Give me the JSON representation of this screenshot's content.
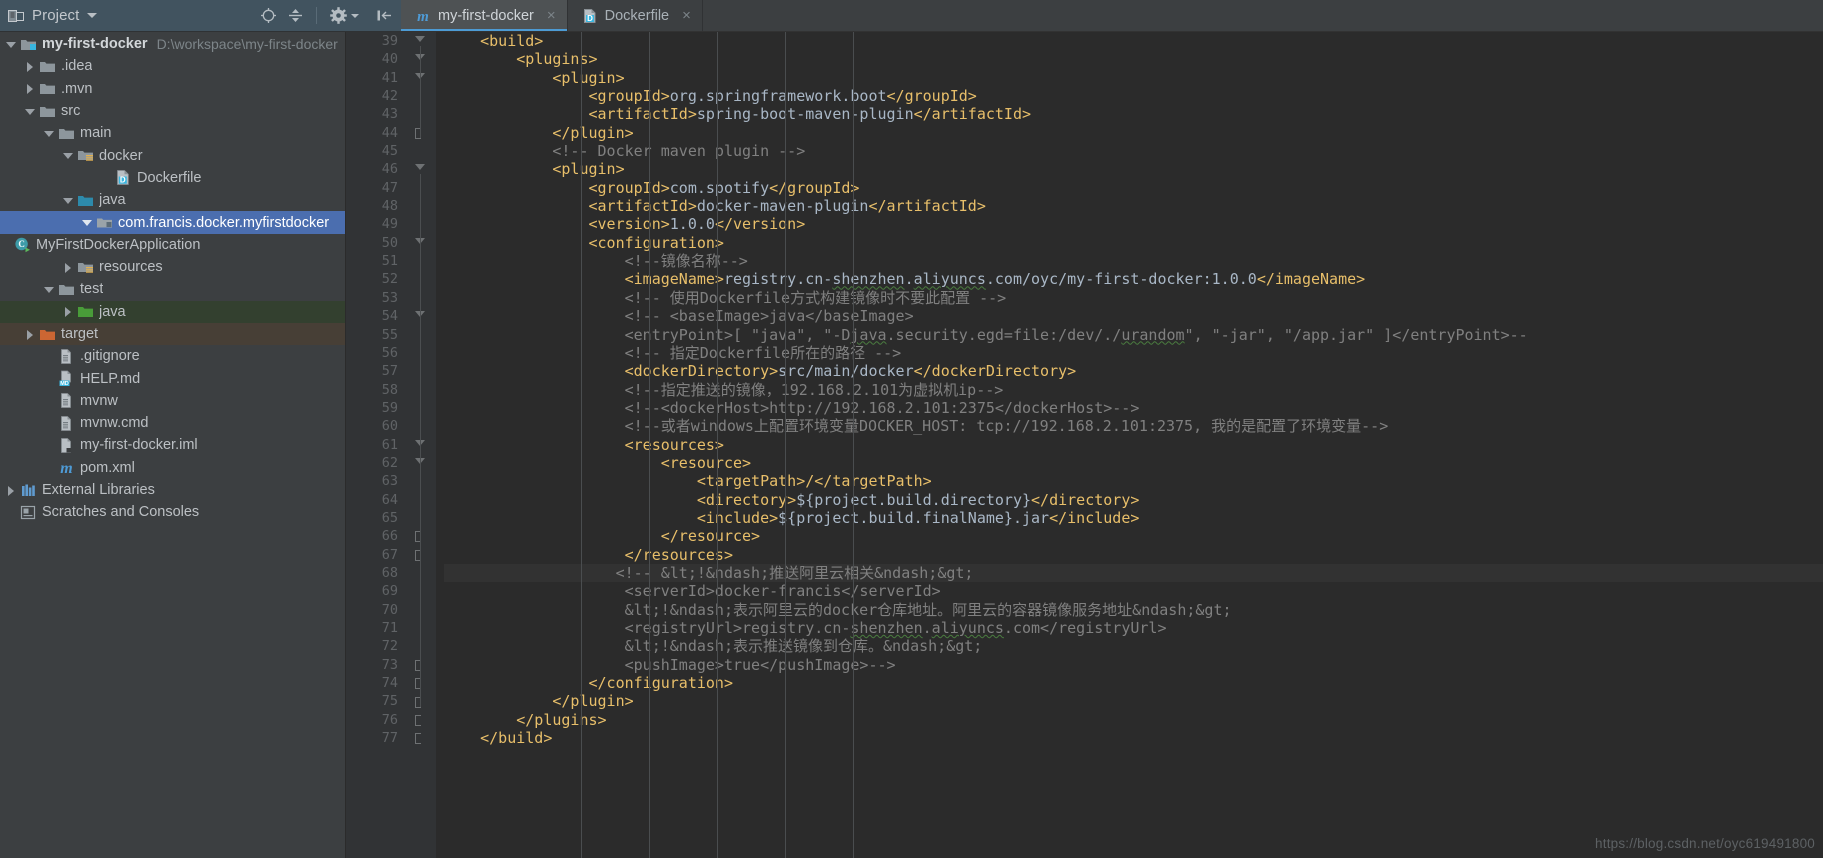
{
  "toolwindow": {
    "title": "Project",
    "icons": [
      {
        "name": "locate-icon",
        "glyph": "target"
      },
      {
        "name": "collapse-all-icon",
        "glyph": "collapse"
      },
      {
        "name": "settings-gear-icon",
        "glyph": "gear"
      },
      {
        "name": "hide-panel-icon",
        "glyph": "hide"
      }
    ]
  },
  "tabs": [
    {
      "label": "my-first-docker",
      "icon": "maven-pom-icon",
      "active": true,
      "close": "×"
    },
    {
      "label": "Dockerfile",
      "icon": "dockerfile-icon",
      "active": false,
      "close": "×"
    }
  ],
  "tree": [
    {
      "label": "my-first-docker",
      "path": "D:\\workspace\\my-first-docker",
      "indent": 0,
      "arrow": "down",
      "icon": "module-icon",
      "bold": true,
      "state": "normal"
    },
    {
      "label": ".idea",
      "path": "",
      "indent": 1,
      "arrow": "right",
      "icon": "folder-icon",
      "bold": false,
      "state": "normal"
    },
    {
      "label": ".mvn",
      "path": "",
      "indent": 1,
      "arrow": "right",
      "icon": "folder-icon",
      "bold": false,
      "state": "normal"
    },
    {
      "label": "src",
      "path": "",
      "indent": 1,
      "arrow": "down",
      "icon": "folder-icon",
      "bold": false,
      "state": "normal"
    },
    {
      "label": "main",
      "path": "",
      "indent": 2,
      "arrow": "down",
      "icon": "folder-icon",
      "bold": false,
      "state": "normal"
    },
    {
      "label": "docker",
      "path": "",
      "indent": 3,
      "arrow": "down",
      "icon": "resource-folder-icon",
      "bold": false,
      "state": "normal"
    },
    {
      "label": "Dockerfile",
      "path": "",
      "indent": 5,
      "arrow": "none",
      "icon": "dockerfile-icon",
      "bold": false,
      "state": "normal"
    },
    {
      "label": "java",
      "path": "",
      "indent": 3,
      "arrow": "down",
      "icon": "source-folder-icon",
      "bold": false,
      "state": "normal"
    },
    {
      "label": "com.francis.docker.myfirstdocker",
      "path": "",
      "indent": 4,
      "arrow": "down",
      "icon": "package-icon",
      "bold": false,
      "state": "selected"
    },
    {
      "label": "MyFirstDockerApplication",
      "path": "",
      "indent": 6,
      "arrow": "none",
      "icon": "java-runnable-class-icon",
      "bold": false,
      "state": "normal"
    },
    {
      "label": "resources",
      "path": "",
      "indent": 3,
      "arrow": "right",
      "icon": "resource-folder-icon",
      "bold": false,
      "state": "normal"
    },
    {
      "label": "test",
      "path": "",
      "indent": 2,
      "arrow": "down",
      "icon": "folder-icon",
      "bold": false,
      "state": "normal"
    },
    {
      "label": "java",
      "path": "",
      "indent": 3,
      "arrow": "right",
      "icon": "test-source-folder-icon",
      "bold": false,
      "state": "test"
    },
    {
      "label": "target",
      "path": "",
      "indent": 1,
      "arrow": "right",
      "icon": "excluded-folder-icon",
      "bold": false,
      "state": "excluded"
    },
    {
      "label": ".gitignore",
      "path": "",
      "indent": 2,
      "arrow": "none",
      "icon": "file-icon",
      "bold": false,
      "state": "normal"
    },
    {
      "label": "HELP.md",
      "path": "",
      "indent": 2,
      "arrow": "none",
      "icon": "markdown-file-icon",
      "bold": false,
      "state": "normal"
    },
    {
      "label": "mvnw",
      "path": "",
      "indent": 2,
      "arrow": "none",
      "icon": "file-icon",
      "bold": false,
      "state": "normal"
    },
    {
      "label": "mvnw.cmd",
      "path": "",
      "indent": 2,
      "arrow": "none",
      "icon": "file-icon",
      "bold": false,
      "state": "normal"
    },
    {
      "label": "my-first-docker.iml",
      "path": "",
      "indent": 2,
      "arrow": "none",
      "icon": "iml-file-icon",
      "bold": false,
      "state": "normal"
    },
    {
      "label": "pom.xml",
      "path": "",
      "indent": 2,
      "arrow": "none",
      "icon": "maven-pom-icon",
      "bold": false,
      "state": "normal"
    },
    {
      "label": "External Libraries",
      "path": "",
      "indent": 0,
      "arrow": "right",
      "icon": "libraries-icon",
      "bold": false,
      "state": "normal"
    },
    {
      "label": "Scratches and Consoles",
      "path": "",
      "indent": 0,
      "arrow": "none",
      "icon": "scratches-icon",
      "bold": false,
      "state": "normal"
    }
  ],
  "editor": {
    "first_line": 39,
    "highlighted_line": 68,
    "run_marker_line": 43,
    "watermark": "https://blog.csdn.net/oyc619491800",
    "lines": [
      {
        "n": 39,
        "indent": 0,
        "fold": "minus",
        "segs": [
          {
            "t": "tag",
            "v": "    <build>"
          }
        ]
      },
      {
        "n": 40,
        "indent": 0,
        "fold": "minus",
        "segs": [
          {
            "t": "tag",
            "v": "        <plugins>"
          }
        ]
      },
      {
        "n": 41,
        "indent": 0,
        "fold": "minus",
        "segs": [
          {
            "t": "tag",
            "v": "            <plugin>"
          }
        ]
      },
      {
        "n": 42,
        "indent": 0,
        "fold": "",
        "segs": [
          {
            "t": "tag",
            "v": "                <groupId>"
          },
          {
            "t": "txt",
            "v": "org.springframework.boot"
          },
          {
            "t": "tag",
            "v": "</groupId>"
          }
        ]
      },
      {
        "n": 43,
        "indent": 0,
        "fold": "run",
        "segs": [
          {
            "t": "tag",
            "v": "                <artifactId>"
          },
          {
            "t": "txt",
            "v": "spring-boot-maven-plugin"
          },
          {
            "t": "tag",
            "v": "</artifactId>"
          }
        ]
      },
      {
        "n": 44,
        "indent": 0,
        "fold": "brkt",
        "segs": [
          {
            "t": "tag",
            "v": "            </plugin>"
          }
        ]
      },
      {
        "n": 45,
        "indent": 0,
        "fold": "",
        "segs": [
          {
            "t": "cmt",
            "v": "            <!-- Docker maven plugin -->"
          }
        ]
      },
      {
        "n": 46,
        "indent": 0,
        "fold": "minus",
        "segs": [
          {
            "t": "tag",
            "v": "            <plugin>"
          }
        ]
      },
      {
        "n": 47,
        "indent": 0,
        "fold": "",
        "segs": [
          {
            "t": "tag",
            "v": "                <groupId>"
          },
          {
            "t": "txt",
            "v": "com.spotify"
          },
          {
            "t": "tag",
            "v": "</groupId>"
          }
        ]
      },
      {
        "n": 48,
        "indent": 0,
        "fold": "",
        "segs": [
          {
            "t": "tag",
            "v": "                <artifactId>"
          },
          {
            "t": "txt",
            "v": "docker-maven-plugin"
          },
          {
            "t": "tag",
            "v": "</artifactId>"
          }
        ]
      },
      {
        "n": 49,
        "indent": 0,
        "fold": "",
        "segs": [
          {
            "t": "tag",
            "v": "                <version>"
          },
          {
            "t": "txt",
            "v": "1.0.0"
          },
          {
            "t": "tag",
            "v": "</version>"
          }
        ]
      },
      {
        "n": 50,
        "indent": 0,
        "fold": "minus",
        "segs": [
          {
            "t": "tag",
            "v": "                <configuration>"
          }
        ]
      },
      {
        "n": 51,
        "indent": 0,
        "fold": "",
        "segs": [
          {
            "t": "cmt",
            "v": "                    <!--镜像名称-->"
          }
        ]
      },
      {
        "n": 52,
        "indent": 0,
        "fold": "",
        "segs": [
          {
            "t": "tag",
            "v": "                    <imageName>"
          },
          {
            "t": "txt",
            "v": "registry.cn-"
          },
          {
            "t": "wavy",
            "v": "shenzhen"
          },
          {
            "t": "txt",
            "v": "."
          },
          {
            "t": "wavy",
            "v": "aliyuncs"
          },
          {
            "t": "txt",
            "v": ".com/oyc/my-first-docker:1.0.0"
          },
          {
            "t": "tag",
            "v": "</imageName>"
          }
        ]
      },
      {
        "n": 53,
        "indent": 0,
        "fold": "",
        "segs": [
          {
            "t": "cmt",
            "v": "                    <!-- 使用Dockerfile方式构建镜像时不要此配置 -->"
          }
        ]
      },
      {
        "n": 54,
        "indent": 0,
        "fold": "minus",
        "segs": [
          {
            "t": "cmt",
            "v": "                    <!-- <baseImage>java</baseImage>"
          }
        ]
      },
      {
        "n": 55,
        "indent": 0,
        "fold": "",
        "segs": [
          {
            "t": "cmt",
            "v": "                    <entryPoint>[ \"java\", \"-D"
          },
          {
            "t": "cmtwavy",
            "v": "java"
          },
          {
            "t": "cmt",
            "v": ".security.egd=file:/dev/./"
          },
          {
            "t": "cmtwavy",
            "v": "urandom"
          },
          {
            "t": "cmt",
            "v": "\", \"-jar\", \"/app.jar\" ]</entryPoint>--"
          }
        ]
      },
      {
        "n": 56,
        "indent": 0,
        "fold": "",
        "segs": [
          {
            "t": "cmt",
            "v": "                    <!-- 指定Dockerfile所在的路径 -->"
          }
        ]
      },
      {
        "n": 57,
        "indent": 0,
        "fold": "",
        "segs": [
          {
            "t": "tag",
            "v": "                    <dockerDirectory>"
          },
          {
            "t": "txt",
            "v": "src/main/docker"
          },
          {
            "t": "tag",
            "v": "</dockerDirectory>"
          }
        ]
      },
      {
        "n": 58,
        "indent": 0,
        "fold": "",
        "segs": [
          {
            "t": "cmt",
            "v": "                    <!--指定推送的镜像，192.168.2.101为虚拟机ip-->"
          }
        ]
      },
      {
        "n": 59,
        "indent": 0,
        "fold": "",
        "segs": [
          {
            "t": "cmt",
            "v": "                    <!--<dockerHost>http://192.168.2.101:2375</dockerHost>-->"
          }
        ]
      },
      {
        "n": 60,
        "indent": 0,
        "fold": "",
        "segs": [
          {
            "t": "cmt",
            "v": "                    <!--或者windows上配置环境变量DOCKER_HOST: tcp://192.168.2.101:2375, 我的是配置了环境变量-->"
          }
        ]
      },
      {
        "n": 61,
        "indent": 0,
        "fold": "minus",
        "segs": [
          {
            "t": "tag",
            "v": "                    <resources>"
          }
        ]
      },
      {
        "n": 62,
        "indent": 0,
        "fold": "minus",
        "segs": [
          {
            "t": "tag",
            "v": "                        <resource>"
          }
        ]
      },
      {
        "n": 63,
        "indent": 0,
        "fold": "",
        "segs": [
          {
            "t": "tag",
            "v": "                            <targetPath>"
          },
          {
            "t": "tag",
            "v": "/</targetPath>"
          }
        ]
      },
      {
        "n": 64,
        "indent": 0,
        "fold": "",
        "segs": [
          {
            "t": "tag",
            "v": "                            <directory>"
          },
          {
            "t": "txt",
            "v": "${project.build.directory}"
          },
          {
            "t": "tag",
            "v": "</directory>"
          }
        ]
      },
      {
        "n": 65,
        "indent": 0,
        "fold": "",
        "segs": [
          {
            "t": "tag",
            "v": "                            <include>"
          },
          {
            "t": "txt",
            "v": "${project.build.finalName}.jar"
          },
          {
            "t": "tag",
            "v": "</include>"
          }
        ]
      },
      {
        "n": 66,
        "indent": 0,
        "fold": "brkt",
        "segs": [
          {
            "t": "tag",
            "v": "                        </resource>"
          }
        ]
      },
      {
        "n": 67,
        "indent": 0,
        "fold": "brkt",
        "segs": [
          {
            "t": "tag",
            "v": "                    </resources>"
          }
        ]
      },
      {
        "n": 68,
        "indent": 0,
        "fold": "",
        "segs": [
          {
            "t": "cmt",
            "v": "                   <!-- &lt;!&ndash;推送阿里云相关&ndash;&gt;"
          }
        ]
      },
      {
        "n": 69,
        "indent": 0,
        "fold": "",
        "segs": [
          {
            "t": "cmt",
            "v": "                    <serverId>docker-francis</serverId>"
          }
        ]
      },
      {
        "n": 70,
        "indent": 0,
        "fold": "",
        "segs": [
          {
            "t": "cmt",
            "v": "                    &lt;!&ndash;表示阿里云的docker仓库地址。阿里云的容器镜像服务地址&ndash;&gt;"
          }
        ]
      },
      {
        "n": 71,
        "indent": 0,
        "fold": "",
        "segs": [
          {
            "t": "cmt",
            "v": "                    <registryUrl>registry.cn-"
          },
          {
            "t": "cmtwavy",
            "v": "shenzhen"
          },
          {
            "t": "cmt",
            "v": "."
          },
          {
            "t": "cmtwavy",
            "v": "aliyuncs"
          },
          {
            "t": "cmt",
            "v": ".com</registryUrl>"
          }
        ]
      },
      {
        "n": 72,
        "indent": 0,
        "fold": "",
        "segs": [
          {
            "t": "cmt",
            "v": "                    &lt;!&ndash;表示推送镜像到仓库。&ndash;&gt;"
          }
        ]
      },
      {
        "n": 73,
        "indent": 0,
        "fold": "brkt",
        "segs": [
          {
            "t": "cmt",
            "v": "                    <pushImage>true</pushImage>-->"
          }
        ]
      },
      {
        "n": 74,
        "indent": 0,
        "fold": "brkt",
        "segs": [
          {
            "t": "tag",
            "v": "                </configuration>"
          }
        ]
      },
      {
        "n": 75,
        "indent": 0,
        "fold": "brkt",
        "segs": [
          {
            "t": "tag",
            "v": "            </plugin>"
          }
        ]
      },
      {
        "n": 76,
        "indent": 0,
        "fold": "brkt",
        "segs": [
          {
            "t": "tag",
            "v": "        </plugins>"
          }
        ]
      },
      {
        "n": 77,
        "indent": 0,
        "fold": "brkt",
        "segs": [
          {
            "t": "tag",
            "v": "    </build>"
          }
        ]
      }
    ]
  },
  "colors": {
    "editor_bg": "#2b2b2b",
    "gutter_bg": "#313335",
    "panel_bg": "#3c3f41",
    "header_bg": "#41535f",
    "selection_blue": "#4b6eaf",
    "tag_orange": "#e8bf6a",
    "text_blue": "#a9b7c6",
    "comment_gray": "#808080",
    "active_tab": "#4e5254",
    "tab_underline": "#4d9bd4"
  }
}
